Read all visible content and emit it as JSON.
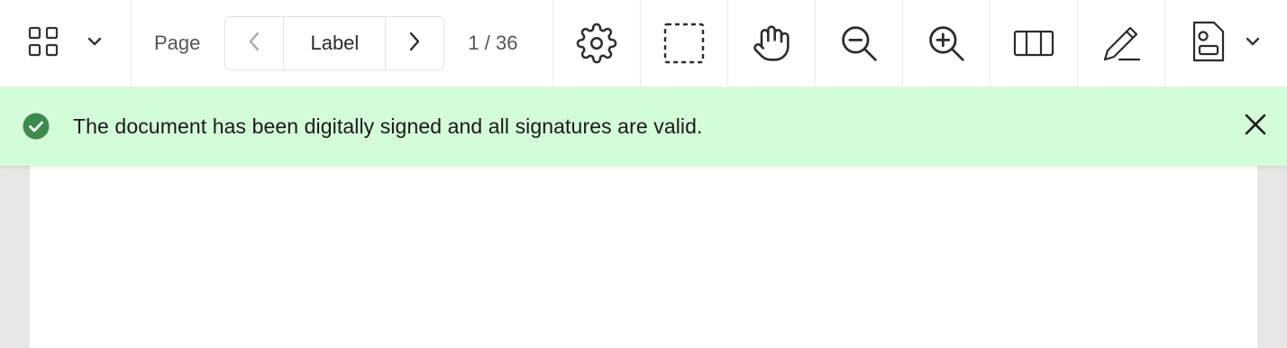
{
  "toolbar": {
    "page_label": "Page",
    "pager_label": "Label",
    "page_count": "1 / 36",
    "icons": {
      "layout": "grid-layout-icon",
      "layout_menu": "chevron-down-icon",
      "prev": "chevron-left-icon",
      "next": "chevron-right-icon",
      "settings": "gear-icon",
      "select": "marquee-select-icon",
      "pan": "hand-icon",
      "zoom_out": "zoom-out-icon",
      "zoom_in": "zoom-in-icon",
      "view_mode": "two-page-view-icon",
      "annotate": "pencil-icon",
      "sign": "document-sign-icon",
      "sign_menu": "chevron-down-icon"
    }
  },
  "banner": {
    "message": "The document has been digitally signed and all signatures are valid.",
    "background": "#d3fcd9",
    "check_color": "#3c8a4c"
  }
}
